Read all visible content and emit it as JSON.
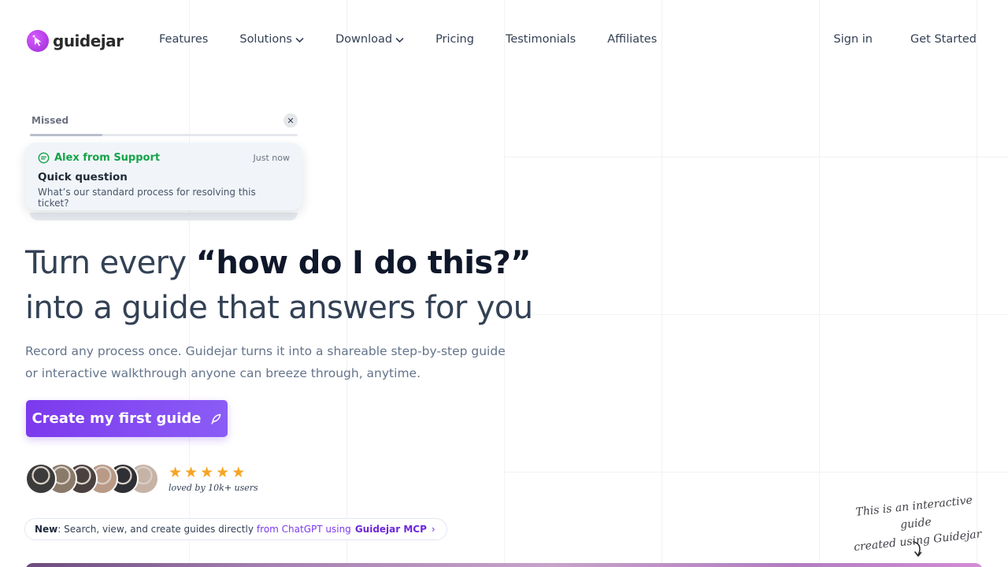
{
  "brand": {
    "name": "guidejar"
  },
  "nav": {
    "items": [
      {
        "label": "Features",
        "dropdown": false
      },
      {
        "label": "Solutions",
        "dropdown": true
      },
      {
        "label": "Download",
        "dropdown": true
      },
      {
        "label": "Pricing",
        "dropdown": false
      },
      {
        "label": "Testimonials",
        "dropdown": false
      },
      {
        "label": "Affiliates",
        "dropdown": false
      }
    ],
    "sign_in": "Sign in",
    "get_started": "Get Started"
  },
  "notification": {
    "status_label": "Missed",
    "progress_fraction": 0.27,
    "from": "Alex from Support",
    "time": "Just now",
    "title": "Quick question",
    "body": "What’s our standard process for resolving this ticket?"
  },
  "hero": {
    "line1_prefix": "Turn every ",
    "line1_emphasis": "“how do I do this?”",
    "line2": "into a guide that answers for you",
    "paragraph": "Record any process once. Guidejar turns it into a shareable step-by-step guide or interactive walkthrough anyone can breeze through, anytime."
  },
  "cta": {
    "label": "Create my first guide"
  },
  "social_proof": {
    "avatar_colors": [
      "#3b3b3b",
      "#8a7a6a",
      "#4a4040",
      "#b99a86",
      "#2f2f36",
      "#c6b3a6"
    ],
    "star_count": 5,
    "loved_text": "loved by 10k+ users"
  },
  "announcement": {
    "new_label": "New",
    "text": ": Search, view, and create guides directly",
    "from_text": "from ChatGPT using",
    "link_text": "Guidejar MCP",
    "chevron": "›"
  },
  "handnote": {
    "line1": "This is an interactive guide",
    "line2": "created using Guidejar"
  },
  "colors": {
    "accent": "#7c3aed",
    "support_green": "#16a34a",
    "star": "#f5a524"
  }
}
